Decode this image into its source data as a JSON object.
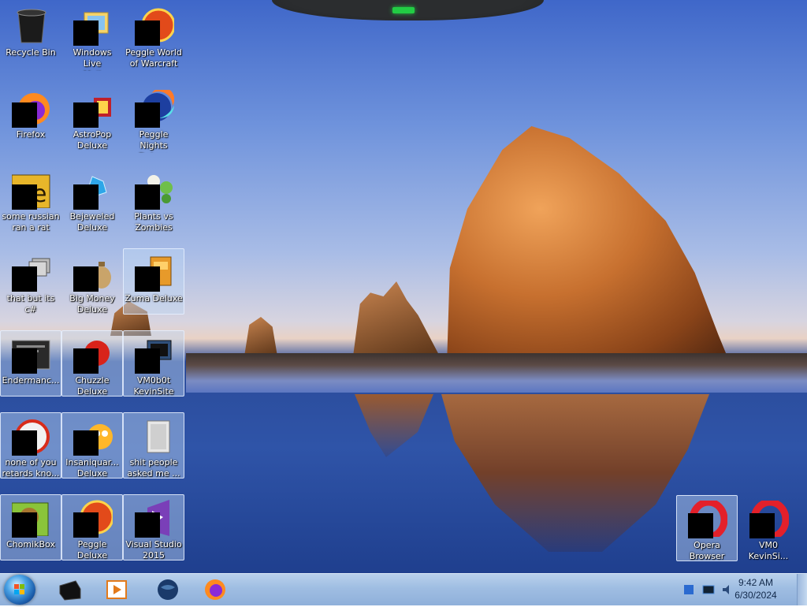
{
  "desktop": {
    "icons": [
      {
        "label": "Recycle Bin"
      },
      {
        "label": "Windows Live\nMail"
      },
      {
        "label": "Peggle World\nof Warcraft ..."
      },
      {
        "label": "Firefox"
      },
      {
        "label": "AstroPop\nDeluxe"
      },
      {
        "label": "Peggle Nights\nDeluxe"
      },
      {
        "label": "some russian\nran a rat"
      },
      {
        "label": "Bejeweled\nDeluxe"
      },
      {
        "label": "Plants vs\nZombies"
      },
      {
        "label": "that but its c#"
      },
      {
        "label": "Big Money\nDeluxe"
      },
      {
        "label": "Zuma Deluxe"
      },
      {
        "label": "Endermanc..."
      },
      {
        "label": "Chuzzle\nDeluxe"
      },
      {
        "label": "VM0b0t\nKevinSite"
      },
      {
        "label": "none of you\nretards kno..."
      },
      {
        "label": "Insaniquar...\nDeluxe"
      },
      {
        "label": "shit people\nasked me ..."
      },
      {
        "label": "ChomikBox"
      },
      {
        "label": "Peggle Deluxe"
      },
      {
        "label": "Visual Studio\n2015"
      },
      {
        "label": "Opera\nBrowser"
      },
      {
        "label": "VM0\nKevinSi..."
      }
    ]
  },
  "taskbar": {
    "clock": {
      "time": "9:42 AM",
      "date": "6/30/2024"
    }
  }
}
